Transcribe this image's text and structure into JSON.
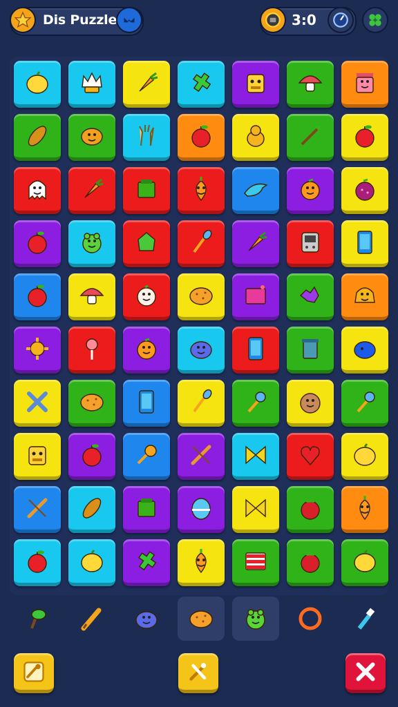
{
  "header": {
    "title": "Dis Puzzle",
    "timer": "3:0",
    "icons": {
      "left": "star-coin-icon",
      "dropdown": "chevron-icon",
      "timer": "clock-icon",
      "right_timer": "gauge-icon",
      "settings": "clover-icon"
    }
  },
  "board": {
    "rows": [
      [
        "cyan",
        "cyan",
        "yellow",
        "cyan",
        "purple",
        "green",
        "orange"
      ],
      [
        "green",
        "green",
        "cyan",
        "orange",
        "yellow",
        "green",
        "yellow"
      ],
      [
        "red",
        "red",
        "red",
        "red",
        "blue",
        "purple",
        "yellow"
      ],
      [
        "purple",
        "cyan",
        "red",
        "red",
        "purple",
        "red",
        "yellow"
      ],
      [
        "blue",
        "yellow",
        "red",
        "yellow",
        "purple",
        "green",
        "orange"
      ],
      [
        "purple",
        "red",
        "purple",
        "cyan",
        "red",
        "green",
        "yellow"
      ],
      [
        "yellow",
        "green",
        "blue",
        "yellow",
        "green",
        "yellow",
        "green"
      ],
      [
        "yellow",
        "purple",
        "blue",
        "purple",
        "cyan",
        "red",
        "yellow"
      ],
      [
        "blue",
        "cyan",
        "purple",
        "purple",
        "yellow",
        "green",
        "orange"
      ],
      [
        "cyan",
        "cyan",
        "purple",
        "yellow",
        "green",
        "green",
        "green"
      ]
    ],
    "icons": [
      [
        "lemon-icon",
        "crown-icon",
        "carrot-icon",
        "cross-icon",
        "robot-icon",
        "mushroom-icon",
        "jar-icon"
      ],
      [
        "peanut-icon",
        "potato-icon",
        "hand-icon",
        "apple-icon",
        "pear-icon",
        "arrow-icon",
        "apple-icon"
      ],
      [
        "ghost-icon",
        "carrot-icon",
        "box-icon",
        "pepper-icon",
        "dolphin-icon",
        "orange-icon",
        "berry-icon"
      ],
      [
        "apple-icon",
        "frog-icon",
        "lettuce-icon",
        "brush-icon",
        "carrot-icon",
        "radio-icon",
        "phone-icon"
      ],
      [
        "apple-icon",
        "mushroom-icon",
        "onion-icon",
        "cookie-icon",
        "screen-icon",
        "splat-icon",
        "bread-icon"
      ],
      [
        "sun-icon",
        "lollipop-icon",
        "orange-icon",
        "blob-icon",
        "phone-icon",
        "trash-icon",
        "whale-icon"
      ],
      [
        "wrench-icon",
        "cookie-icon",
        "phone-icon",
        "brush-icon",
        "mic-icon",
        "cake-icon",
        "mic-icon"
      ],
      [
        "robot-icon",
        "apple-icon",
        "key-icon",
        "pen-icon",
        "bow-icon",
        "heart-icon",
        "lemon-icon"
      ],
      [
        "pen-icon",
        "peanut-icon",
        "box-icon",
        "egg-icon",
        "bow-icon",
        "tomato-icon",
        "pepper-icon"
      ],
      [
        "apple-icon",
        "lemon-icon",
        "cross-icon",
        "pepper-icon",
        "bars-icon",
        "tomato-icon",
        "lemon-icon"
      ]
    ]
  },
  "tray": {
    "items": [
      "plant-icon",
      "pencil-icon",
      "blob-icon",
      "cookie-icon",
      "frog-icon",
      "ring-icon",
      "pipette-icon"
    ],
    "highlighted": [
      3,
      4
    ]
  },
  "buttons": {
    "left": "shuffle-icon",
    "middle": "magic-icon",
    "right": "close-icon"
  },
  "colors": {
    "cyan": "#18c8ee",
    "yellow": "#f5e410",
    "purple": "#8b1ee0",
    "green": "#2fb318",
    "orange": "#ff8c10",
    "red": "#ec1c1c",
    "blue": "#1e86ec",
    "bg": "#1c2b52"
  }
}
